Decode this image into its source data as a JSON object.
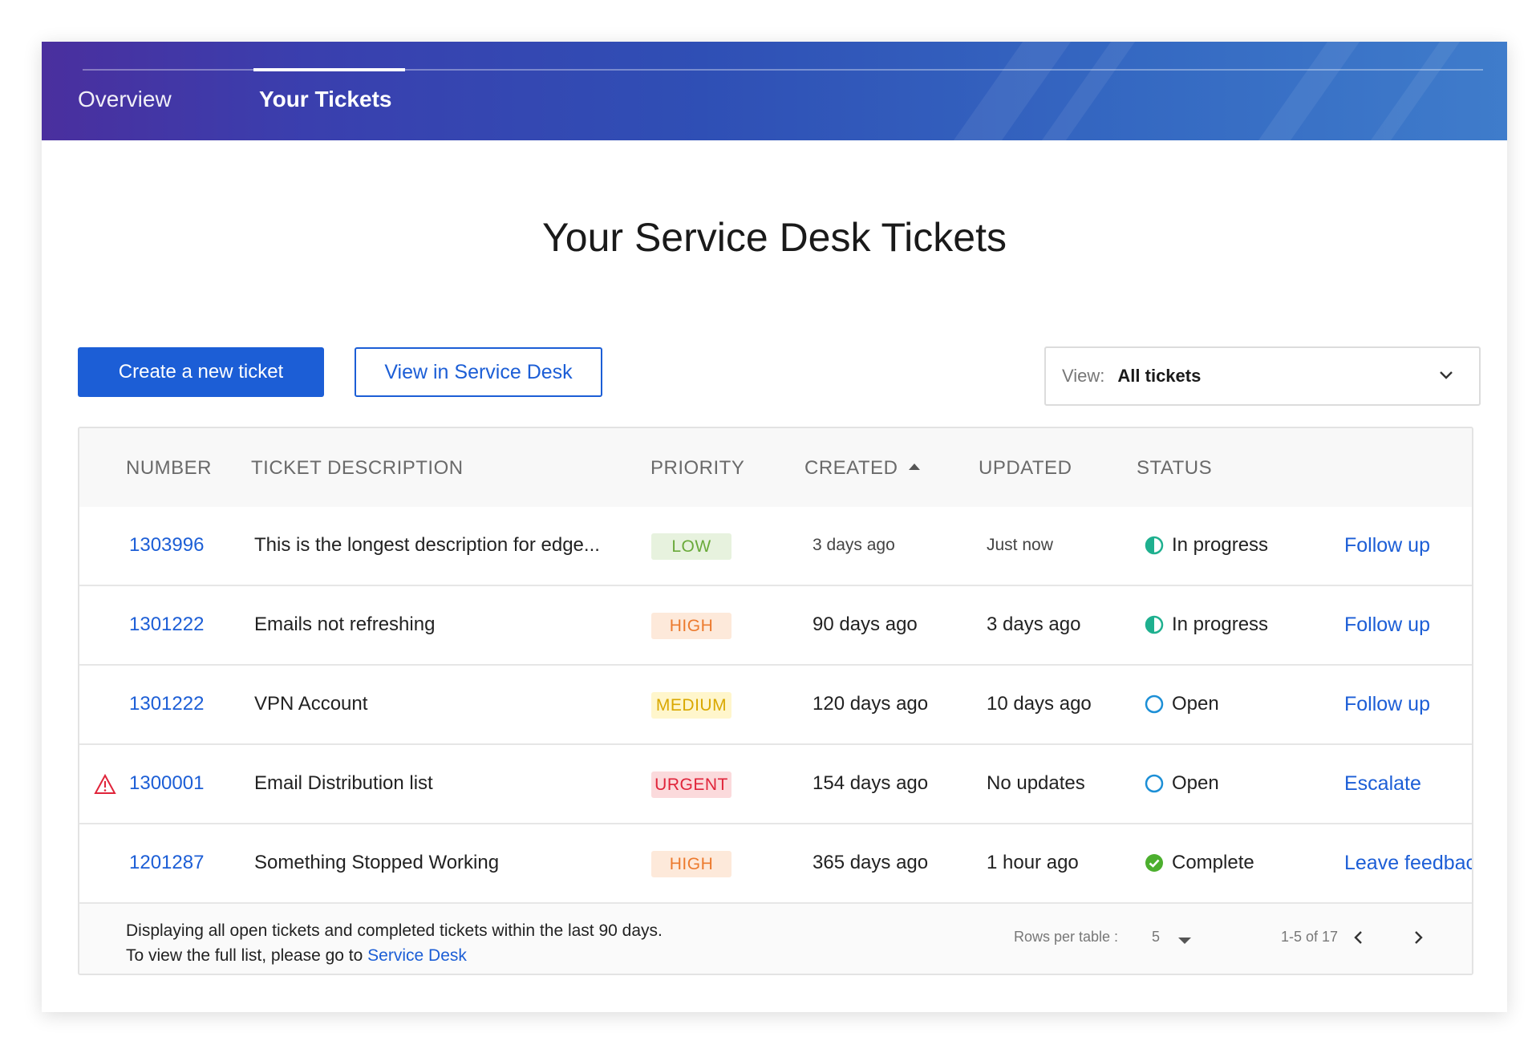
{
  "nav": {
    "tabs": [
      {
        "label": "Overview"
      },
      {
        "label": "Your Tickets",
        "active": true
      }
    ]
  },
  "page": {
    "title": "Your Service Desk Tickets"
  },
  "actions": {
    "create_label": "Create a new ticket",
    "view_sd_label": "View in Service Desk"
  },
  "view_filter": {
    "label": "View:",
    "value": "All tickets"
  },
  "table": {
    "headers": {
      "number": "NUMBER",
      "description": "TICKET DESCRIPTION",
      "priority": "PRIORITY",
      "created": "CREATED",
      "updated": "UPDATED",
      "status": "STATUS"
    },
    "sort": {
      "column": "created",
      "direction": "ascending"
    },
    "rows": [
      {
        "number": "1303996",
        "description": "This is the longest description for edge...",
        "priority": "LOW",
        "created": "3 days ago",
        "updated": "Just now",
        "status": "In progress",
        "status_icon": "half-circle-icon",
        "action": "Follow up",
        "warning": false
      },
      {
        "number": "1301222",
        "description": "Emails not refreshing",
        "priority": "HIGH",
        "created": "90 days ago",
        "updated": "3 days ago",
        "status": "In progress",
        "status_icon": "half-circle-icon",
        "action": "Follow up",
        "warning": false
      },
      {
        "number": "1301222",
        "description": "VPN Account",
        "priority": "MEDIUM",
        "created": "120 days ago",
        "updated": "10 days ago",
        "status": "Open",
        "status_icon": "open-circle-icon",
        "action": "Follow up",
        "warning": false
      },
      {
        "number": "1300001",
        "description": "Email Distribution list",
        "priority": "URGENT",
        "created": "154 days ago",
        "updated": "No updates",
        "status": "Open",
        "status_icon": "open-circle-icon",
        "action": "Escalate",
        "warning": true
      },
      {
        "number": "1201287",
        "description": "Something Stopped Working",
        "priority": "HIGH",
        "created": "365 days ago",
        "updated": "1 hour ago",
        "status": "Complete",
        "status_icon": "check-circle-icon",
        "action": "Leave feedback",
        "warning": false
      }
    ],
    "priority_colors": {
      "LOW": {
        "text": "#6aaa3a",
        "bg": "#e7f2de"
      },
      "HIGH": {
        "text": "#ec7a2e",
        "bg": "#fde9da"
      },
      "MEDIUM": {
        "text": "#d9a800",
        "bg": "#fff6cc"
      },
      "URGENT": {
        "text": "#e0243a",
        "bg": "#fbdadc"
      }
    },
    "status_colors": {
      "in_progress": "#1fb08f",
      "open": "#1c8fd6",
      "complete": "#4caf2e"
    },
    "footer": {
      "line1": "Displaying all open tickets and completed tickets within the last 90 days.",
      "line2_prefix": "To view the full list, please go to ",
      "line2_link": "Service Desk",
      "rows_per_table_label": "Rows per table :",
      "rows_per_table_value": "5",
      "range": "1-5 of 17"
    }
  },
  "colors": {
    "accent": "#1c5ed6",
    "banner_start": "#4a2f9e",
    "banner_end": "#3f7ccb"
  }
}
